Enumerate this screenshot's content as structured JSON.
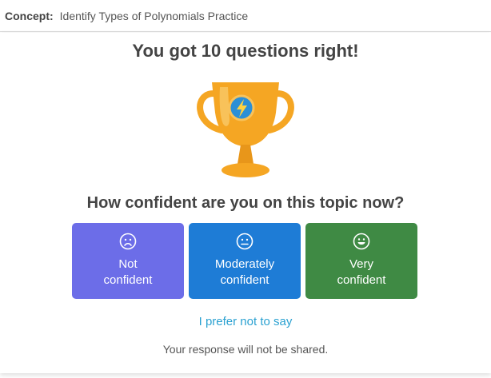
{
  "concept": {
    "label": "Concept:",
    "title": "Identify Types of Polynomials Practice"
  },
  "result": {
    "title": "You got 10 questions right!",
    "trophy_icon": "trophy-icon",
    "colors": {
      "trophy": "#f5a623",
      "badge": "#2b8fd6"
    }
  },
  "confidence": {
    "question": "How confident are you on this topic now?",
    "options": [
      {
        "line1": "Not",
        "line2": "confident",
        "icon": "frown-face-icon",
        "color": "#6c6de8"
      },
      {
        "line1": "Moderately",
        "line2": "confident",
        "icon": "neutral-face-icon",
        "color": "#1e7cd6"
      },
      {
        "line1": "Very",
        "line2": "confident",
        "icon": "smile-face-icon",
        "color": "#3f8a44"
      }
    ],
    "skip_label": "I prefer not to say",
    "note": "Your response will not be shared."
  }
}
